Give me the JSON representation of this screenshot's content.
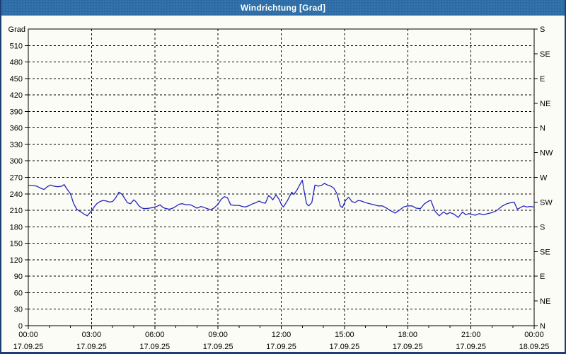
{
  "window": {
    "title": "Windrichtung [Grad]"
  },
  "colors": {
    "titlebar": "#2d6ca4",
    "frame": "#1c3e75",
    "background": "#fcfcf7",
    "line": "#2424c0",
    "grid": "#000000",
    "text": "#000000",
    "title_text": "#ffffff"
  },
  "chart_data": {
    "type": "line",
    "title": "Windrichtung [Grad]",
    "ylabel": "Grad",
    "ylim": [
      0,
      540
    ],
    "xlim_hours": [
      0,
      24
    ],
    "grid": "dashed",
    "y_ticks": [
      0,
      30,
      60,
      90,
      120,
      150,
      180,
      210,
      240,
      270,
      300,
      330,
      360,
      390,
      420,
      450,
      480,
      510
    ],
    "compass_ticks": [
      {
        "deg": 0,
        "label": "N"
      },
      {
        "deg": 45,
        "label": "NE"
      },
      {
        "deg": 90,
        "label": "E"
      },
      {
        "deg": 135,
        "label": "SE"
      },
      {
        "deg": 180,
        "label": "S"
      },
      {
        "deg": 225,
        "label": "SW"
      },
      {
        "deg": 270,
        "label": "W"
      },
      {
        "deg": 315,
        "label": "NW"
      },
      {
        "deg": 360,
        "label": "N"
      },
      {
        "deg": 405,
        "label": "NE"
      },
      {
        "deg": 450,
        "label": "E"
      },
      {
        "deg": 495,
        "label": "SE"
      },
      {
        "deg": 540,
        "label": "S"
      }
    ],
    "x_ticks": [
      {
        "hour": 0,
        "time": "00:00",
        "date": "17.09.25"
      },
      {
        "hour": 3,
        "time": "03:00",
        "date": "17.09.25"
      },
      {
        "hour": 6,
        "time": "06:00",
        "date": "17.09.25"
      },
      {
        "hour": 9,
        "time": "09:00",
        "date": "17.09.25"
      },
      {
        "hour": 12,
        "time": "12:00",
        "date": "17.09.25"
      },
      {
        "hour": 15,
        "time": "15:00",
        "date": "17.09.25"
      },
      {
        "hour": 18,
        "time": "18:00",
        "date": "17.09.25"
      },
      {
        "hour": 21,
        "time": "21:00",
        "date": "17.09.25"
      },
      {
        "hour": 24,
        "time": "00:00",
        "date": "18.09.25"
      }
    ],
    "x_minor_step_hours": 1,
    "series": [
      {
        "name": "Windrichtung",
        "color": "#2424c0",
        "points": [
          [
            0,
            255
          ],
          [
            0.2,
            255
          ],
          [
            0.4,
            254
          ],
          [
            0.6,
            250
          ],
          [
            0.75,
            248
          ],
          [
            0.9,
            253
          ],
          [
            1.05,
            256
          ],
          [
            1.2,
            254
          ],
          [
            1.4,
            253
          ],
          [
            1.6,
            254
          ],
          [
            1.7,
            257
          ],
          [
            1.85,
            248
          ],
          [
            2.0,
            240
          ],
          [
            2.15,
            222
          ],
          [
            2.3,
            212
          ],
          [
            2.5,
            207
          ],
          [
            2.65,
            203
          ],
          [
            2.8,
            200
          ],
          [
            2.95,
            207
          ],
          [
            3.1,
            215
          ],
          [
            3.25,
            222
          ],
          [
            3.4,
            226
          ],
          [
            3.55,
            228
          ],
          [
            3.7,
            227
          ],
          [
            3.85,
            225
          ],
          [
            4.0,
            226
          ],
          [
            4.15,
            233
          ],
          [
            4.3,
            243
          ],
          [
            4.45,
            239
          ],
          [
            4.6,
            230
          ],
          [
            4.7,
            224
          ],
          [
            4.85,
            222
          ],
          [
            5.0,
            229
          ],
          [
            5.1,
            226
          ],
          [
            5.25,
            218
          ],
          [
            5.4,
            214
          ],
          [
            5.55,
            213
          ],
          [
            5.75,
            214
          ],
          [
            5.9,
            215
          ],
          [
            6.1,
            217
          ],
          [
            6.25,
            220
          ],
          [
            6.4,
            215
          ],
          [
            6.55,
            213
          ],
          [
            6.7,
            212
          ],
          [
            6.85,
            214
          ],
          [
            7.0,
            217
          ],
          [
            7.15,
            221
          ],
          [
            7.3,
            222
          ],
          [
            7.5,
            220
          ],
          [
            7.7,
            220
          ],
          [
            7.85,
            217
          ],
          [
            8.0,
            214
          ],
          [
            8.2,
            217
          ],
          [
            8.35,
            215
          ],
          [
            8.5,
            213
          ],
          [
            8.65,
            211
          ],
          [
            8.8,
            214
          ],
          [
            9.0,
            221
          ],
          [
            9.15,
            230
          ],
          [
            9.3,
            235
          ],
          [
            9.45,
            233
          ],
          [
            9.6,
            220
          ],
          [
            9.8,
            219
          ],
          [
            10.0,
            219
          ],
          [
            10.15,
            217
          ],
          [
            10.3,
            216
          ],
          [
            10.5,
            219
          ],
          [
            10.65,
            222
          ],
          [
            10.8,
            224
          ],
          [
            10.95,
            227
          ],
          [
            11.1,
            224
          ],
          [
            11.25,
            223
          ],
          [
            11.4,
            237
          ],
          [
            11.5,
            234
          ],
          [
            11.6,
            229
          ],
          [
            11.75,
            238
          ],
          [
            11.9,
            230
          ],
          [
            12.0,
            221
          ],
          [
            12.1,
            216
          ],
          [
            12.3,
            228
          ],
          [
            12.5,
            243
          ],
          [
            12.6,
            239
          ],
          [
            12.75,
            247
          ],
          [
            12.9,
            258
          ],
          [
            13.0,
            265
          ],
          [
            13.1,
            242
          ],
          [
            13.2,
            222
          ],
          [
            13.3,
            218
          ],
          [
            13.45,
            224
          ],
          [
            13.6,
            256
          ],
          [
            13.75,
            254
          ],
          [
            13.9,
            255
          ],
          [
            14.05,
            259
          ],
          [
            14.2,
            256
          ],
          [
            14.35,
            254
          ],
          [
            14.5,
            250
          ],
          [
            14.65,
            240
          ],
          [
            14.8,
            218
          ],
          [
            14.9,
            215
          ],
          [
            15.05,
            228
          ],
          [
            15.2,
            234
          ],
          [
            15.35,
            226
          ],
          [
            15.5,
            224
          ],
          [
            15.65,
            228
          ],
          [
            15.8,
            227
          ],
          [
            16.0,
            224
          ],
          [
            16.2,
            222
          ],
          [
            16.4,
            220
          ],
          [
            16.6,
            218
          ],
          [
            16.8,
            218
          ],
          [
            17.0,
            214
          ],
          [
            17.2,
            209
          ],
          [
            17.4,
            205
          ],
          [
            17.6,
            210
          ],
          [
            17.8,
            216
          ],
          [
            18.0,
            218
          ],
          [
            18.2,
            218
          ],
          [
            18.4,
            214
          ],
          [
            18.6,
            213
          ],
          [
            18.8,
            222
          ],
          [
            19.0,
            227
          ],
          [
            19.1,
            228
          ],
          [
            19.3,
            208
          ],
          [
            19.5,
            200
          ],
          [
            19.7,
            207
          ],
          [
            19.85,
            203
          ],
          [
            20.0,
            206
          ],
          [
            20.2,
            203
          ],
          [
            20.4,
            197
          ],
          [
            20.6,
            207
          ],
          [
            20.75,
            202
          ],
          [
            20.9,
            204
          ],
          [
            21.0,
            203
          ],
          [
            21.2,
            201
          ],
          [
            21.4,
            204
          ],
          [
            21.6,
            202
          ],
          [
            21.8,
            204
          ],
          [
            22.0,
            206
          ],
          [
            22.2,
            209
          ],
          [
            22.5,
            218
          ],
          [
            22.7,
            222
          ],
          [
            22.9,
            224
          ],
          [
            23.05,
            225
          ],
          [
            23.2,
            212
          ],
          [
            23.35,
            215
          ],
          [
            23.5,
            218
          ],
          [
            23.65,
            216
          ],
          [
            23.8,
            217
          ],
          [
            24.0,
            216
          ]
        ]
      }
    ]
  }
}
